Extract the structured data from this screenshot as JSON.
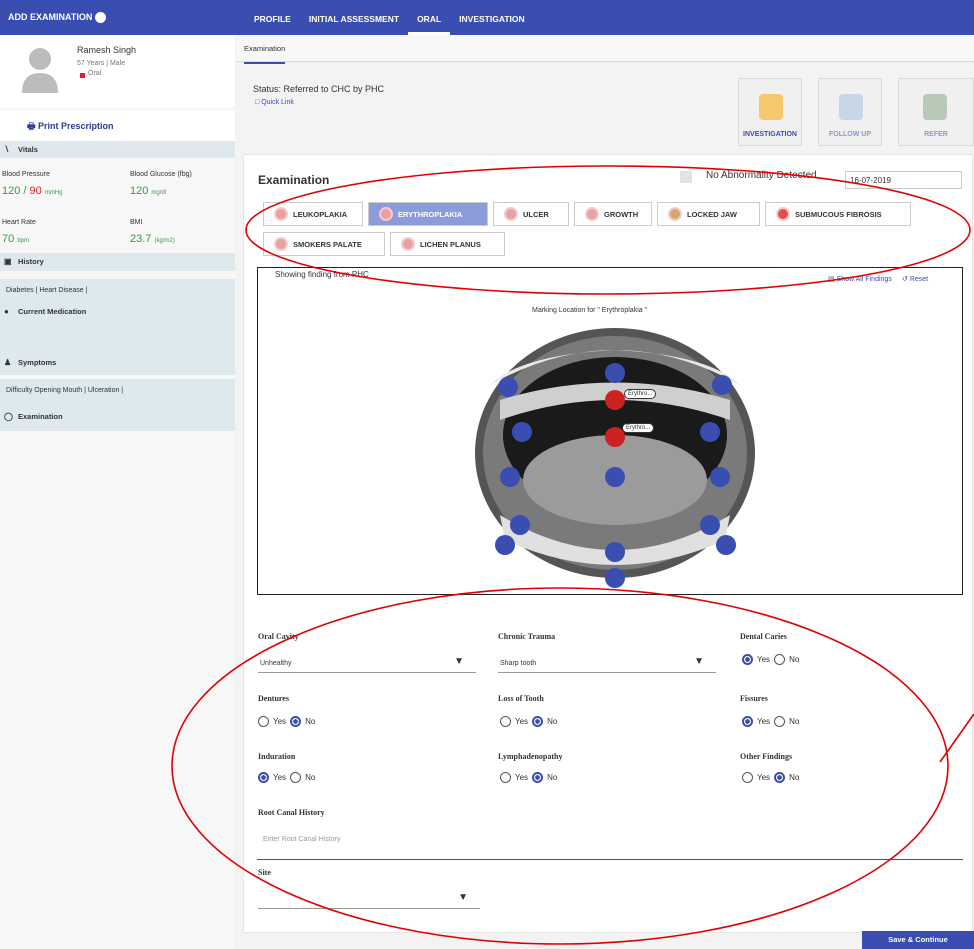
{
  "header": {
    "title": "ADD EXAMINATION",
    "tabs": [
      "PROFILE",
      "INITIAL ASSESSMENT",
      "ORAL",
      "INVESTIGATION"
    ],
    "active_tab": "ORAL"
  },
  "patient": {
    "name": "Ramesh Singh",
    "age_gender": "57 Years | Male",
    "tag": "Oral"
  },
  "sidebar": {
    "print": "Print Prescription",
    "vitals": "Vitals",
    "bp_label": "Blood Pressure",
    "bp_sys": "120",
    "bp_dia": "90",
    "bp_unit": "mmHg",
    "bg_label": "Blood Glucose (fbg)",
    "bg_value": "120",
    "bg_unit": "mg/dl",
    "hr_label": "Heart Rate",
    "hr_value": "70",
    "hr_unit": "bpm",
    "bmi_label": "BMI",
    "bmi_value": "23.7",
    "bmi_unit": "(kg/m2)",
    "history": "History",
    "history_items": "Diabetes | Heart Disease |",
    "medication": "Current Medication",
    "symptoms": "Symptoms",
    "symptom_items": "Difficulty Opening Mouth | Ulceration |",
    "examination": "Examination"
  },
  "subtab": "Examination",
  "status": "Status: Referred to CHC by PHC",
  "quick_link": "Quick Link",
  "cards": [
    "INVESTIGATION",
    "FOLLOW UP",
    "REFER"
  ],
  "exam": {
    "title": "Examination",
    "nad": "No Abnormality Detected",
    "date": "16-07-2019",
    "chips": [
      "LEUKOPLAKIA",
      "ERYTHROPLAKIA",
      "ULCER",
      "GROWTH",
      "LOCKED JAW",
      "SUBMUCOUS FIBROSIS",
      "SMOKERS PALATE",
      "LICHEN PLANUS"
    ],
    "selected_chip": "ERYTHROPLAKIA",
    "showing": "Showing finding from PHC",
    "show_all": "Show All Findings",
    "reset": "Reset",
    "marking": "Marking Location for \" Erythroplakia \"",
    "marker_label": "Erythro..."
  },
  "form": {
    "oral_cavity_label": "Oral Cavity",
    "oral_cavity_value": "Unhealthy",
    "chronic_trauma_label": "Chronic Trauma",
    "chronic_trauma_value": "Sharp tooth",
    "dental_caries_label": "Dental Caries",
    "dentures_label": "Dentures",
    "loss_tooth_label": "Loss of Tooth",
    "fissures_label": "Fissures",
    "induration_label": "Induration",
    "lymph_label": "Lymphadenopathy",
    "other_label": "Other Findings",
    "yes": "Yes",
    "no": "No",
    "root_canal_label": "Root Canal History",
    "root_canal_placeholder": "Enter Root Canal History",
    "site_label": "Site",
    "dental_caries": "Yes",
    "dentures": "No",
    "loss_tooth": "No",
    "fissures": "Yes",
    "induration": "Yes",
    "lymph": "No",
    "other": "No"
  },
  "save": "Save & Continue"
}
